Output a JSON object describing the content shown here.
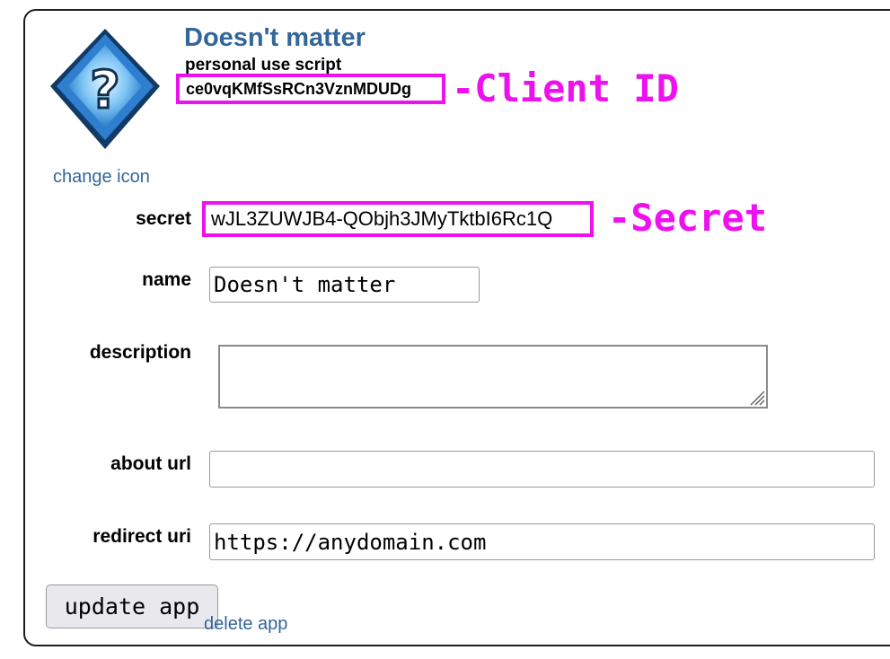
{
  "app": {
    "title": "Doesn't matter",
    "type_label": "personal use script",
    "client_id": "ce0vqKMfSsRCn3VznMDUDg",
    "change_icon_label": "change icon",
    "icon": "question-mark-diamond-icon"
  },
  "annotations": {
    "client_id_label": "-Client ID",
    "secret_label": "-Secret",
    "highlight_color": "#ee10ee"
  },
  "form": {
    "secret_label": "secret",
    "secret_value": "wJL3ZUWJB4-QObjh3JMyTktbI6Rc1Q",
    "name_label": "name",
    "name_value": "Doesn't matter",
    "description_label": "description",
    "description_value": "",
    "about_url_label": "about url",
    "about_url_value": "",
    "redirect_uri_label": "redirect uri",
    "redirect_uri_value": "https://anydomain.com"
  },
  "actions": {
    "update_label": "update app",
    "delete_label": "delete app"
  },
  "colors": {
    "title": "#336699",
    "link": "#336699",
    "border": "#1c1c1c"
  }
}
